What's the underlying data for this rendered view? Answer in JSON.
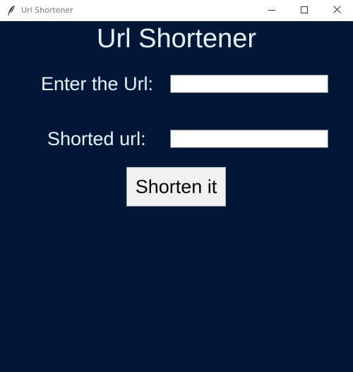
{
  "window": {
    "title": "Url Shortener",
    "icons": {
      "app": "feather-icon",
      "minimize": "minimize-icon",
      "maximize": "maximize-icon",
      "close": "close-icon"
    }
  },
  "main": {
    "heading": "Url Shortener",
    "url_label": "Enter the Url:",
    "url_value": "",
    "short_label": "Shorted url:",
    "short_value": "",
    "button_label": "Shorten it"
  },
  "colors": {
    "background": "#001738",
    "text": "#e6f4ff",
    "button_face": "#f0f0f0"
  }
}
